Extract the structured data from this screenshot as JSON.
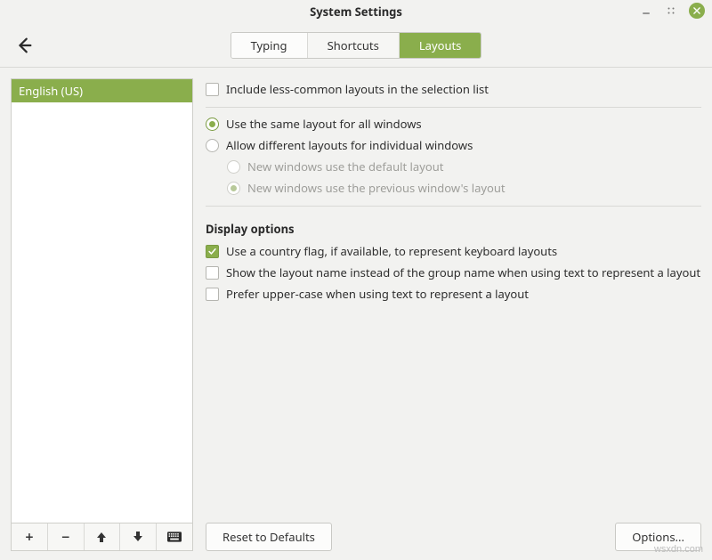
{
  "window": {
    "title": "System Settings"
  },
  "tabs": {
    "typing": "Typing",
    "shortcuts": "Shortcuts",
    "layouts": "Layouts",
    "active": "layouts"
  },
  "sidebar": {
    "items": [
      {
        "label": "English (US)",
        "selected": true
      }
    ]
  },
  "options": {
    "include_less_common": {
      "label": "Include less-common layouts in the selection list",
      "checked": false
    },
    "layout_mode": {
      "same_all": "Use the same layout for all windows",
      "allow_different": "Allow different layouts for individual windows",
      "selected": "same_all",
      "sub": {
        "use_default": "New windows use the default layout",
        "use_previous": "New windows use the previous window's layout",
        "selected": "use_previous"
      }
    },
    "display_section_title": "Display options",
    "country_flag": {
      "label": "Use a country flag, if available,  to represent keyboard layouts",
      "checked": true
    },
    "layout_name_instead": {
      "label": "Show the layout name instead of the group name when using text to represent a layout",
      "checked": false
    },
    "prefer_upper": {
      "label": "Prefer upper-case when using text to represent a layout",
      "checked": false
    }
  },
  "buttons": {
    "reset": "Reset to Defaults",
    "options": "Options..."
  },
  "watermark": "wsxdn.com"
}
